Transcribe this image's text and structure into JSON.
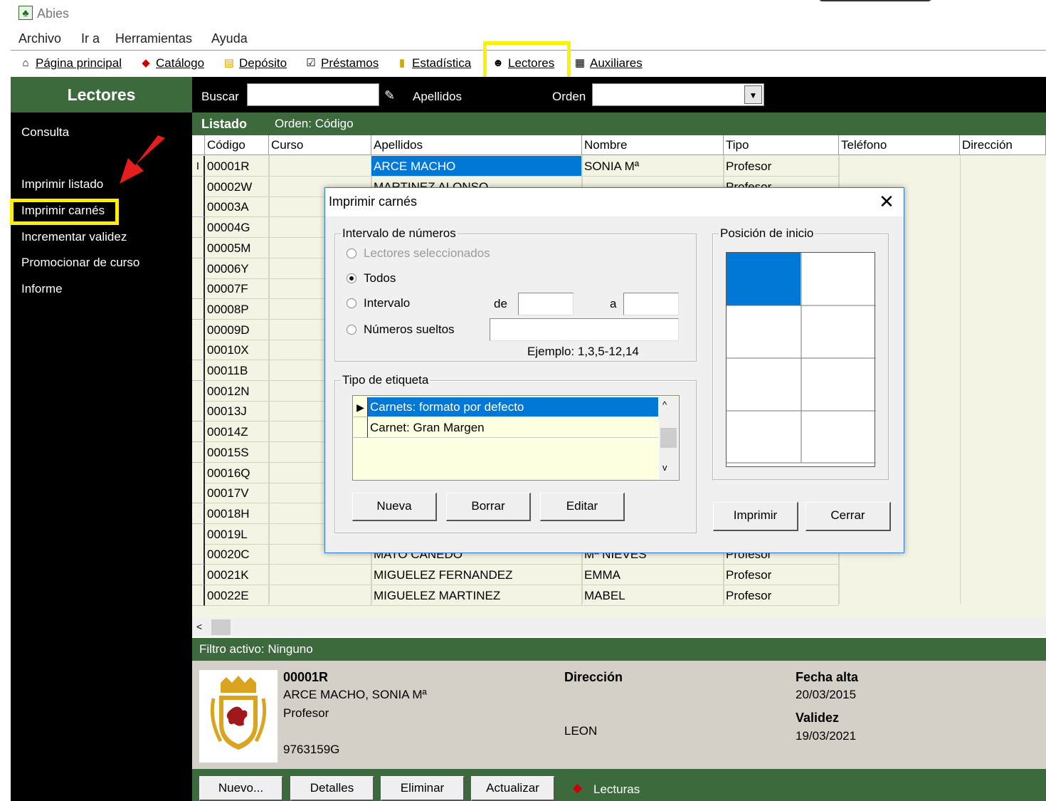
{
  "app": {
    "title": "Abies"
  },
  "menubar": [
    "Archivo",
    "Ir a",
    "Herramientas",
    "Ayuda"
  ],
  "toolbar": {
    "home": "Página principal",
    "catalog": "Catálogo",
    "deposit": "Depósito",
    "loans": "Préstamos",
    "stats": "Estadística",
    "readers": "Lectores",
    "aux": "Auxiliares"
  },
  "sidebar": {
    "title": "Lectores",
    "items": [
      "Consulta",
      "Imprimir listado",
      "Imprimir carnés",
      "Incrementar validez",
      "Promocionar de curso",
      "Informe"
    ]
  },
  "search": {
    "label": "Buscar",
    "value": "",
    "field": "Apellidos",
    "order_label": "Orden",
    "order_value": ""
  },
  "listado": {
    "label": "Listado",
    "order": "Orden: Código"
  },
  "table": {
    "columns": [
      "Código",
      "Curso",
      "Apellidos",
      "Nombre",
      "Tipo",
      "Teléfono",
      "Dirección"
    ],
    "rows": [
      {
        "codigo": "00001R",
        "apellidos": "ARCE MACHO",
        "nombre": "SONIA Mª",
        "tipo": "Profesor"
      },
      {
        "codigo": "00002W",
        "apellidos": "MARTINEZ ALONSO",
        "nombre": "",
        "tipo": "Profesor"
      },
      {
        "codigo": "00003A"
      },
      {
        "codigo": "00004G"
      },
      {
        "codigo": "00005M"
      },
      {
        "codigo": "00006Y"
      },
      {
        "codigo": "00007F"
      },
      {
        "codigo": "00008P"
      },
      {
        "codigo": "00009D"
      },
      {
        "codigo": "00010X"
      },
      {
        "codigo": "00011B"
      },
      {
        "codigo": "00012N"
      },
      {
        "codigo": "00013J"
      },
      {
        "codigo": "00014Z"
      },
      {
        "codigo": "00015S"
      },
      {
        "codigo": "00016Q"
      },
      {
        "codigo": "00017V"
      },
      {
        "codigo": "00018H"
      },
      {
        "codigo": "00019L"
      },
      {
        "codigo": "00020C",
        "apellidos": "MATO CANEDO",
        "nombre": "Mª NIEVES",
        "tipo": "Profesor"
      },
      {
        "codigo": "00021K",
        "apellidos": "MIGUELEZ FERNANDEZ",
        "nombre": "EMMA",
        "tipo": "Profesor"
      },
      {
        "codigo": "00022E",
        "apellidos": "MIGUELEZ MARTINEZ",
        "nombre": "MABEL",
        "tipo": "Profesor"
      }
    ]
  },
  "filter": "Filtro activo: Ninguno",
  "detail": {
    "code": "00001R",
    "name": "ARCE MACHO, SONIA Mª",
    "type": "Profesor",
    "id": "9763159G",
    "address_label": "Dirección",
    "address": "LEON",
    "date_label": "Fecha alta",
    "date": "20/03/2015",
    "validity_label": "Validez",
    "validity": "19/03/2021"
  },
  "bottom_buttons": [
    "Nuevo...",
    "Detalles",
    "Eliminar",
    "Actualizar"
  ],
  "bottom_readings": "Lecturas",
  "dialog": {
    "title": "Imprimir carnés",
    "range_group": "Intervalo de números",
    "opt_selected": "Lectores seleccionados",
    "opt_all": "Todos",
    "opt_interval": "Intervalo",
    "de": "de",
    "a": "a",
    "opt_numbers": "Números sueltos",
    "example": "Ejemplo: 1,3,5-12,14",
    "label_group": "Tipo de etiqueta",
    "label_types": [
      "Carnets: formato por defecto",
      "Carnet: Gran Margen"
    ],
    "btn_new": "Nueva",
    "btn_delete": "Borrar",
    "btn_edit": "Editar",
    "position_group": "Posición de inicio",
    "btn_print": "Imprimir",
    "btn_close": "Cerrar"
  },
  "colors": {
    "green": "#3d6a3d",
    "highlight": "#ffef00",
    "selection": "#0078d7"
  }
}
